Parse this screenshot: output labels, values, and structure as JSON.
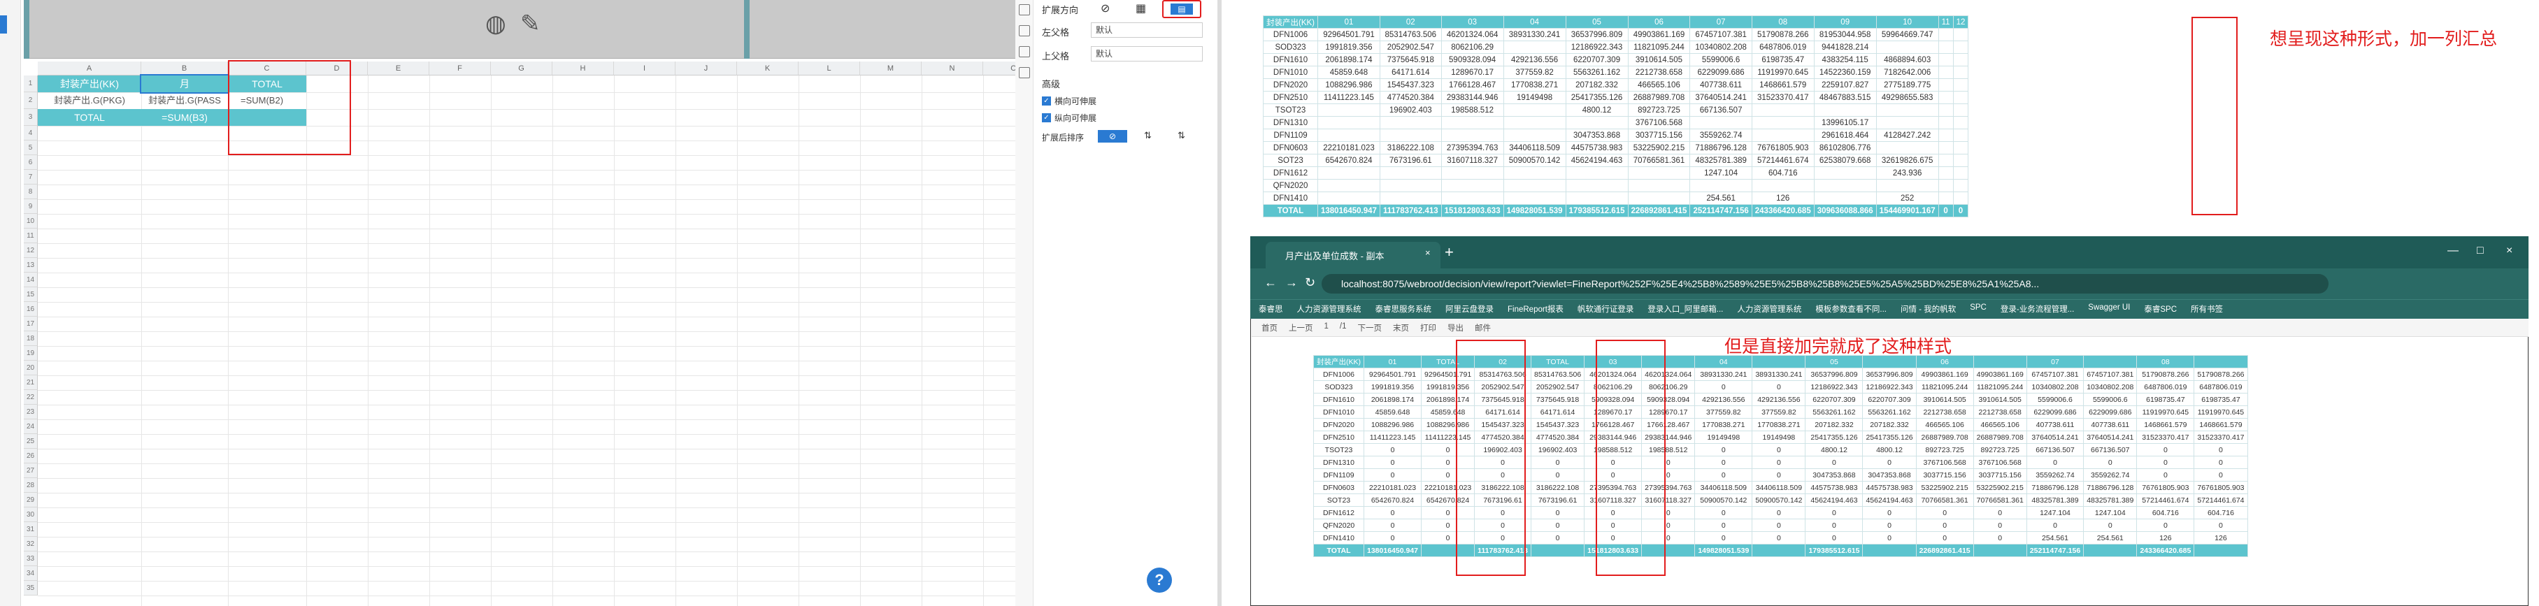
{
  "designer": {
    "columns": [
      "A",
      "B",
      "C",
      "D",
      "E",
      "F",
      "G",
      "H",
      "I",
      "J",
      "K",
      "L",
      "M",
      "N",
      "O",
      "P"
    ],
    "rows": [
      "1",
      "2",
      "3",
      "4",
      "5",
      "6",
      "7",
      "8",
      "9",
      "10",
      "11",
      "12",
      "13",
      "14",
      "15",
      "16",
      "17",
      "18",
      "19",
      "20",
      "21",
      "22",
      "23",
      "24",
      "25",
      "26",
      "27",
      "28",
      "29",
      "30",
      "31",
      "32",
      "33",
      "34",
      "35"
    ],
    "cells": {
      "a1": "封装产出(KK)",
      "b1": "月",
      "c1": "TOTAL",
      "a2": "封装产出.G(PKG)",
      "b2": "封装产出.G(PASS",
      "c2": "=SUM(B2)",
      "a3": "TOTAL",
      "b3": "=SUM(B3)"
    }
  },
  "panel": {
    "expand_dir_label": "扩展方向",
    "left_parent_label": "左父格",
    "left_parent_value": "默认",
    "top_parent_label": "上父格",
    "top_parent_value": "默认",
    "section_label": "高级",
    "chk1": "横向可伸展",
    "chk2": "纵向可伸展",
    "sort_label": "扩展后排序"
  },
  "top_report": {
    "headers": [
      "封装产出(KK)",
      "01",
      "02",
      "03",
      "04",
      "05",
      "06",
      "07",
      "08",
      "09",
      "10",
      "11",
      "12"
    ],
    "rows": [
      [
        "DFN1006",
        "92964501.791",
        "85314763.506",
        "46201324.064",
        "38931330.241",
        "36537996.809",
        "49903861.169",
        "67457107.381",
        "51790878.266",
        "81953044.958",
        "59964669.747",
        "",
        ""
      ],
      [
        "SOD323",
        "1991819.356",
        "2052902.547",
        "8062106.29",
        "",
        "12186922.343",
        "11821095.244",
        "10340802.208",
        "6487806.019",
        "9441828.214",
        "",
        "",
        ""
      ],
      [
        "DFN1610",
        "2061898.174",
        "7375645.918",
        "5909328.094",
        "4292136.556",
        "6220707.309",
        "3910614.505",
        "5599006.6",
        "6198735.47",
        "4383254.115",
        "4868894.603",
        "",
        ""
      ],
      [
        "DFN1010",
        "45859.648",
        "64171.614",
        "1289670.17",
        "377559.82",
        "5563261.162",
        "2212738.658",
        "6229099.686",
        "11919970.645",
        "14522360.159",
        "7182642.006",
        "",
        ""
      ],
      [
        "DFN2020",
        "1088296.986",
        "1545437.323",
        "1766128.467",
        "1770838.271",
        "207182.332",
        "466565.106",
        "407738.611",
        "1468661.579",
        "2259107.827",
        "2775189.775",
        "",
        ""
      ],
      [
        "DFN2510",
        "11411223.145",
        "4774520.384",
        "29383144.946",
        "19149498",
        "25417355.126",
        "26887989.708",
        "37640514.241",
        "31523370.417",
        "48467883.515",
        "49298655.583",
        "",
        ""
      ],
      [
        "TSOT23",
        "",
        "196902.403",
        "198588.512",
        "",
        "4800.12",
        "892723.725",
        "667136.507",
        "",
        "",
        "",
        "",
        ""
      ],
      [
        "DFN1310",
        "",
        "",
        "",
        "",
        "",
        "3767106.568",
        "",
        "",
        "13996105.17",
        "",
        "",
        ""
      ],
      [
        "DFN1109",
        "",
        "",
        "",
        "",
        "3047353.868",
        "3037715.156",
        "3559262.74",
        "",
        "2961618.464",
        "4128427.242",
        "",
        ""
      ],
      [
        "DFN0603",
        "22210181.023",
        "3186222.108",
        "27395394.763",
        "34406118.509",
        "44575738.983",
        "53225902.215",
        "71886796.128",
        "76761805.903",
        "86102806.776",
        "",
        "",
        ""
      ],
      [
        "SOT23",
        "6542670.824",
        "7673196.61",
        "31607118.327",
        "50900570.142",
        "45624194.463",
        "70766581.361",
        "48325781.389",
        "57214461.674",
        "62538079.668",
        "32619826.675",
        "",
        ""
      ],
      [
        "DFN1612",
        "",
        "",
        "",
        "",
        "",
        "",
        "1247.104",
        "604.716",
        "",
        "243.936",
        "",
        ""
      ],
      [
        "QFN2020",
        "",
        "",
        "",
        "",
        "",
        "",
        "",
        "",
        "",
        "",
        "",
        ""
      ],
      [
        "DFN1410",
        "",
        "",
        "",
        "",
        "",
        "",
        "254.561",
        "126",
        "",
        "252",
        "",
        ""
      ]
    ],
    "total": [
      "TOTAL",
      "138016450.947",
      "111783762.413",
      "151812803.633",
      "149828051.539",
      "179385512.615",
      "226892861.415",
      "252114747.156",
      "243366420.685",
      "309636088.866",
      "154469901.167",
      "0",
      "0"
    ]
  },
  "annotations": {
    "top": "想呈现这种形式，加一列汇总",
    "bottom": "但是直接加完就成了这种样式"
  },
  "browser": {
    "tab_title": "月产出及单位成数 - 副本",
    "url": "localhost:8075/webroot/decision/view/report?viewlet=FineReport%252F%25E4%25B8%2589%25E5%25B8%25B8%25E5%25A5%25BD%25E8%25A1%25A8...",
    "bookmarks": [
      "泰睿思",
      "人力资源管理系统",
      "泰睿思服务系统",
      "阿里云盘登录",
      "FineReport报表",
      "帆软通行证登录",
      "登录入口_阿里邮箱...",
      "人力资源管理系统",
      "模板参数查看不同...",
      "问情 - 我的帆软",
      "SPC",
      "登录-业务流程管理...",
      "Swagger UI",
      "泰睿SPC",
      "所有书签"
    ],
    "toolbar": [
      "首页",
      "上一页",
      "1",
      "/1",
      "下一页",
      "末页",
      "打印",
      "导出",
      "邮件"
    ]
  },
  "bottom_report": {
    "headers": [
      "封装产出(KK)",
      "01",
      "TOTAL",
      "02",
      "TOTAL",
      "03",
      "",
      "04",
      "",
      "05",
      "",
      "06",
      "",
      "07",
      "",
      "08",
      ""
    ],
    "rows": [
      [
        "DFN1006",
        "92964501.791",
        "92964501.791",
        "85314763.506",
        "85314763.506",
        "46201324.064",
        "46201324.064",
        "38931330.241",
        "38931330.241",
        "36537996.809",
        "36537996.809",
        "49903861.169",
        "49903861.169",
        "67457107.381",
        "67457107.381",
        "51790878.266",
        "51790878.266"
      ],
      [
        "SOD323",
        "1991819.356",
        "1991819.356",
        "2052902.547",
        "2052902.547",
        "8062106.29",
        "8062106.29",
        "0",
        "0",
        "12186922.343",
        "12186922.343",
        "11821095.244",
        "11821095.244",
        "10340802.208",
        "10340802.208",
        "6487806.019",
        "6487806.019"
      ],
      [
        "DFN1610",
        "2061898.174",
        "2061898.174",
        "7375645.918",
        "7375645.918",
        "5909328.094",
        "5909328.094",
        "4292136.556",
        "4292136.556",
        "6220707.309",
        "6220707.309",
        "3910614.505",
        "3910614.505",
        "5599006.6",
        "5599006.6",
        "6198735.47",
        "6198735.47"
      ],
      [
        "DFN1010",
        "45859.648",
        "45859.648",
        "64171.614",
        "64171.614",
        "1289670.17",
        "1289670.17",
        "377559.82",
        "377559.82",
        "5563261.162",
        "5563261.162",
        "2212738.658",
        "2212738.658",
        "6229099.686",
        "6229099.686",
        "11919970.645",
        "11919970.645"
      ],
      [
        "DFN2020",
        "1088296.986",
        "1088296.986",
        "1545437.323",
        "1545437.323",
        "1766128.467",
        "1766128.467",
        "1770838.271",
        "1770838.271",
        "207182.332",
        "207182.332",
        "466565.106",
        "466565.106",
        "407738.611",
        "407738.611",
        "1468661.579",
        "1468661.579"
      ],
      [
        "DFN2510",
        "11411223.145",
        "11411223.145",
        "4774520.384",
        "4774520.384",
        "29383144.946",
        "29383144.946",
        "19149498",
        "19149498",
        "25417355.126",
        "25417355.126",
        "26887989.708",
        "26887989.708",
        "37640514.241",
        "37640514.241",
        "31523370.417",
        "31523370.417"
      ],
      [
        "TSOT23",
        "0",
        "0",
        "196902.403",
        "196902.403",
        "198588.512",
        "198588.512",
        "0",
        "0",
        "4800.12",
        "4800.12",
        "892723.725",
        "892723.725",
        "667136.507",
        "667136.507",
        "0",
        "0"
      ],
      [
        "DFN1310",
        "0",
        "0",
        "0",
        "0",
        "0",
        "0",
        "0",
        "0",
        "0",
        "0",
        "3767106.568",
        "3767106.568",
        "0",
        "0",
        "0",
        "0"
      ],
      [
        "DFN1109",
        "0",
        "0",
        "0",
        "0",
        "0",
        "0",
        "0",
        "0",
        "3047353.868",
        "3047353.868",
        "3037715.156",
        "3037715.156",
        "3559262.74",
        "3559262.74",
        "0",
        "0"
      ],
      [
        "DFN0603",
        "22210181.023",
        "22210181.023",
        "3186222.108",
        "3186222.108",
        "27395394.763",
        "27395394.763",
        "34406118.509",
        "34406118.509",
        "44575738.983",
        "44575738.983",
        "53225902.215",
        "53225902.215",
        "71886796.128",
        "71886796.128",
        "76761805.903",
        "76761805.903"
      ],
      [
        "SOT23",
        "6542670.824",
        "6542670.824",
        "7673196.61",
        "7673196.61",
        "31607118.327",
        "31607118.327",
        "50900570.142",
        "50900570.142",
        "45624194.463",
        "45624194.463",
        "70766581.361",
        "70766581.361",
        "48325781.389",
        "48325781.389",
        "57214461.674",
        "57214461.674"
      ],
      [
        "DFN1612",
        "0",
        "0",
        "0",
        "0",
        "0",
        "0",
        "0",
        "0",
        "0",
        "0",
        "0",
        "0",
        "1247.104",
        "1247.104",
        "604.716",
        "604.716"
      ],
      [
        "QFN2020",
        "0",
        "0",
        "0",
        "0",
        "0",
        "0",
        "0",
        "0",
        "0",
        "0",
        "0",
        "0",
        "0",
        "0",
        "0",
        "0"
      ],
      [
        "DFN1410",
        "0",
        "0",
        "0",
        "0",
        "0",
        "0",
        "0",
        "0",
        "0",
        "0",
        "0",
        "0",
        "254.561",
        "254.561",
        "126",
        "126"
      ]
    ],
    "total": [
      "TOTAL",
      "138016450.947",
      "",
      "111783762.413",
      "",
      "151812803.633",
      "",
      "149828051.539",
      "",
      "179385512.615",
      "",
      "226892861.415",
      "",
      "252114747.156",
      "",
      "243366420.685",
      ""
    ]
  }
}
